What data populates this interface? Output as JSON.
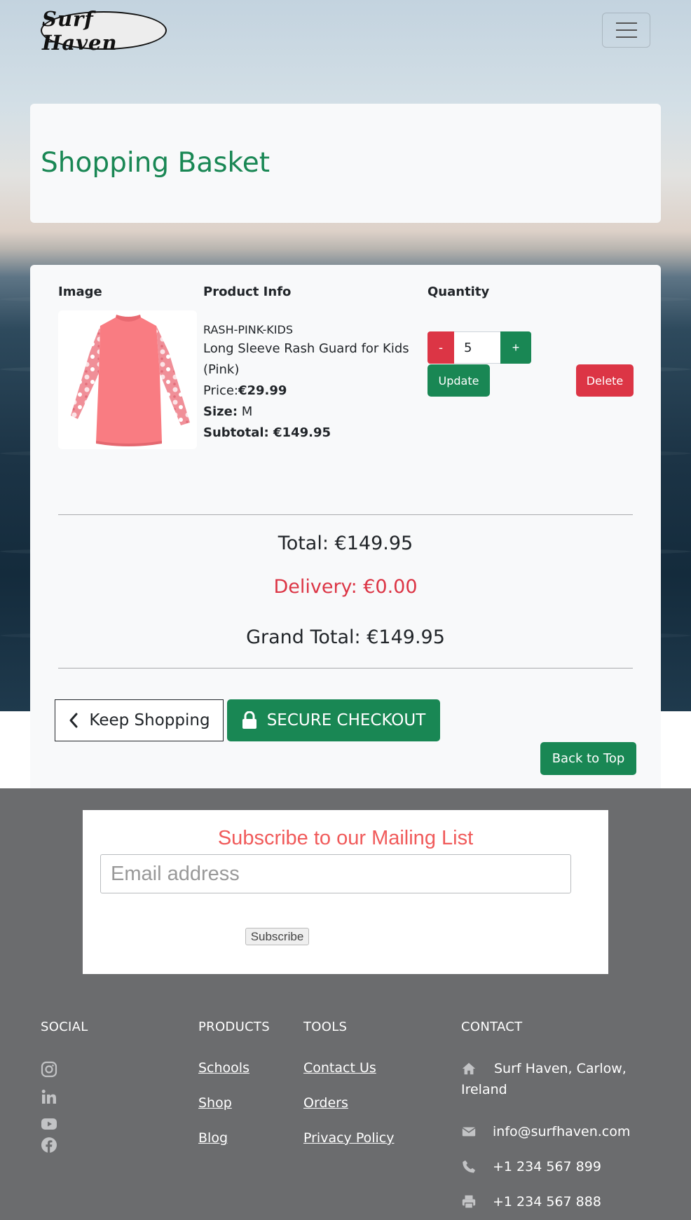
{
  "header": {
    "logo_text": "Surf Haven",
    "menu_icon": "hamburger-icon"
  },
  "page": {
    "title": "Shopping Basket"
  },
  "basket": {
    "columns": {
      "image": "Image",
      "product_info": "Product Info",
      "quantity": "Quantity"
    },
    "item": {
      "sku": "RASH-PINK-KIDS",
      "name": "Long Sleeve Rash Guard for Kids (Pink)",
      "price_label": "Price:",
      "price": "€29.99",
      "size_label": "Size:",
      "size": "M",
      "subtotal": "Subtotal: €149.95",
      "quantity": "5",
      "minus": "-",
      "plus": "+",
      "update_label": "Update",
      "delete_label": "Delete"
    },
    "total": "Total: €149.95",
    "delivery": "Delivery: €0.00",
    "grand_total": "Grand Total: €149.95",
    "keep_shopping_label": "Keep Shopping",
    "secure_checkout_label": "SECURE CHECKOUT",
    "back_to_top_label": "Back to Top"
  },
  "newsletter": {
    "title": "Subscribe to our Mailing List",
    "email_placeholder": "Email address",
    "subscribe_label": "Subscribe"
  },
  "footer": {
    "social": {
      "heading": "SOCIAL",
      "icons": [
        "instagram-icon",
        "linkedin-icon",
        "youtube-icon",
        "facebook-icon"
      ]
    },
    "products": {
      "heading": "PRODUCTS",
      "links": [
        "Schools",
        "Shop",
        "Blog"
      ]
    },
    "tools": {
      "heading": "TOOLS",
      "links": [
        "Contact Us",
        "Orders",
        "Privacy Policy"
      ]
    },
    "contact": {
      "heading": "CONTACT",
      "address": "Surf Haven, Carlow, Ireland",
      "email": "info@surfhaven.com",
      "phone": "+1 234 567 899",
      "fax": "+1 234 567 888"
    }
  },
  "colors": {
    "primary": "#198754",
    "danger": "#dc3545",
    "footer_bg": "#6b6c6e",
    "newsletter_title": "#f05a5a"
  }
}
